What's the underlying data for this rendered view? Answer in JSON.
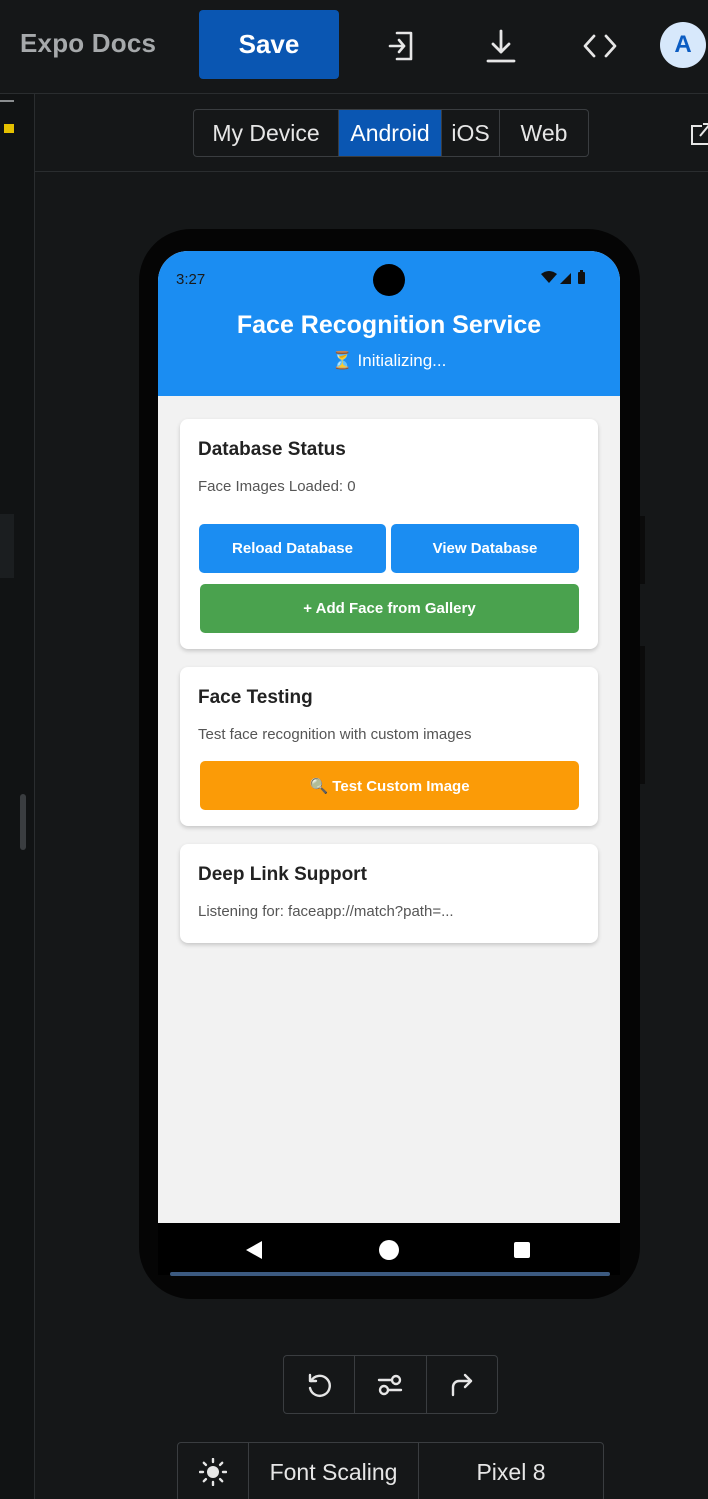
{
  "topbar": {
    "title": "Expo Docs",
    "save_label": "Save",
    "icons": [
      "import-icon",
      "download-icon",
      "code-icon"
    ],
    "avatar_initial": "A"
  },
  "platform_tabs": [
    "My Device",
    "Android",
    "iOS",
    "Web"
  ],
  "selected_platform": "Android",
  "device": {
    "status_time": "3:27",
    "header": {
      "title": "Face Recognition Service",
      "subtitle": "⏳ Initializing...",
      "color": "#1b8df2"
    },
    "cards": {
      "database": {
        "title": "Database Status",
        "text": "Face Images Loaded: 0",
        "reload_label": "Reload Database",
        "view_label": "View Database",
        "add_label": "+ Add Face from Gallery"
      },
      "testing": {
        "title": "Face Testing",
        "text": "Test face recognition with custom images",
        "test_label": "🔍 Test Custom Image"
      },
      "deeplink": {
        "title": "Deep Link Support",
        "text": "Listening for: faceapp://match?path=..."
      }
    }
  },
  "controls": {
    "icons": [
      "rotate-icon",
      "settings-sliders-icon",
      "share-icon"
    ]
  },
  "bottom_bar": {
    "theme_icon": "sun-icon",
    "font_scaling_label": "Font Scaling",
    "device_label": "Pixel 8"
  },
  "colors": {
    "accent": "#0a56b2",
    "app_blue": "#1b8df2",
    "app_green": "#4aa24e",
    "app_orange": "#fb9b07"
  }
}
